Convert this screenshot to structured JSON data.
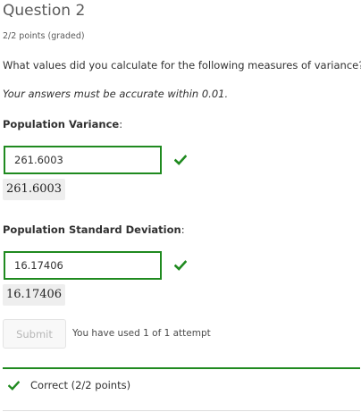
{
  "problem": {
    "title": "Question 2",
    "points": "2/2 points (graded)",
    "prompt": "What values did you calculate for the following measures of variance?",
    "note": "Your answers must be accurate within 0.01."
  },
  "answers": [
    {
      "label": "Population Variance",
      "colon": ":",
      "value": "261.6003",
      "rendered": "261.6003",
      "status_icon": "check-icon"
    },
    {
      "label": "Population Standard Deviation",
      "colon": ":",
      "value": "16.17406",
      "rendered": "16.17406",
      "status_icon": "check-icon"
    }
  ],
  "actions": {
    "submit_label": "Submit",
    "attempts_text": "You have used 1 of 1 attempt"
  },
  "status": {
    "icon": "check-icon",
    "text": "Correct (2/2 points)"
  },
  "colors": {
    "correct": "#1f8a1f",
    "text": "#313131",
    "muted": "#5a5a5a"
  }
}
